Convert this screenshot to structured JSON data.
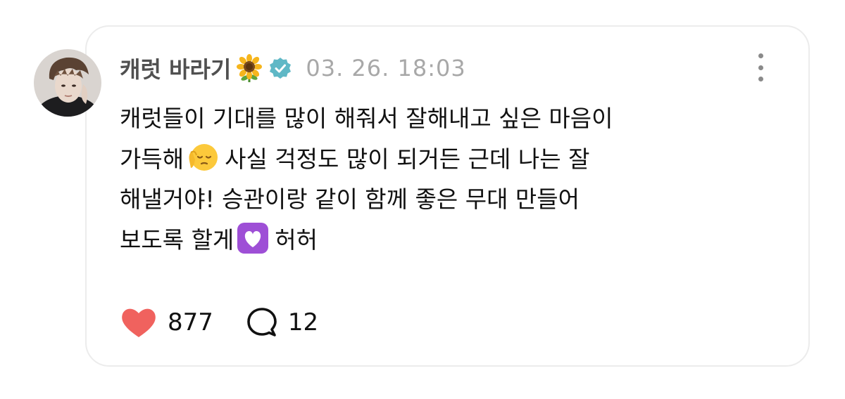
{
  "post": {
    "author_name": "캐럿 바라기",
    "author_emoji": "sunflower-icon",
    "verified_icon": "verified-badge-icon",
    "timestamp": "03. 26. 18:03",
    "more_icon": "more-vertical-icon",
    "body_lines": [
      "캐럿들이 기대를 많이 해줘서 잘해내고 싶은 마음이",
      "가득해",
      "사실 걱정도 많이 되거든 근데 나는 잘",
      "해낼거야! 승관이랑 같이 함께 좋은 무대 만들어",
      "보도록 할게",
      "허허"
    ],
    "inline_emojis": [
      "relieved-face-emoji",
      "purple-heart-emoji"
    ],
    "likes": "877",
    "comments": "12"
  },
  "colors": {
    "card_border": "#ececec",
    "name": "#505050",
    "timestamp": "#a8a8a8",
    "heart": "#f0625e",
    "verified": "#5fb8c6",
    "text": "#111111"
  }
}
